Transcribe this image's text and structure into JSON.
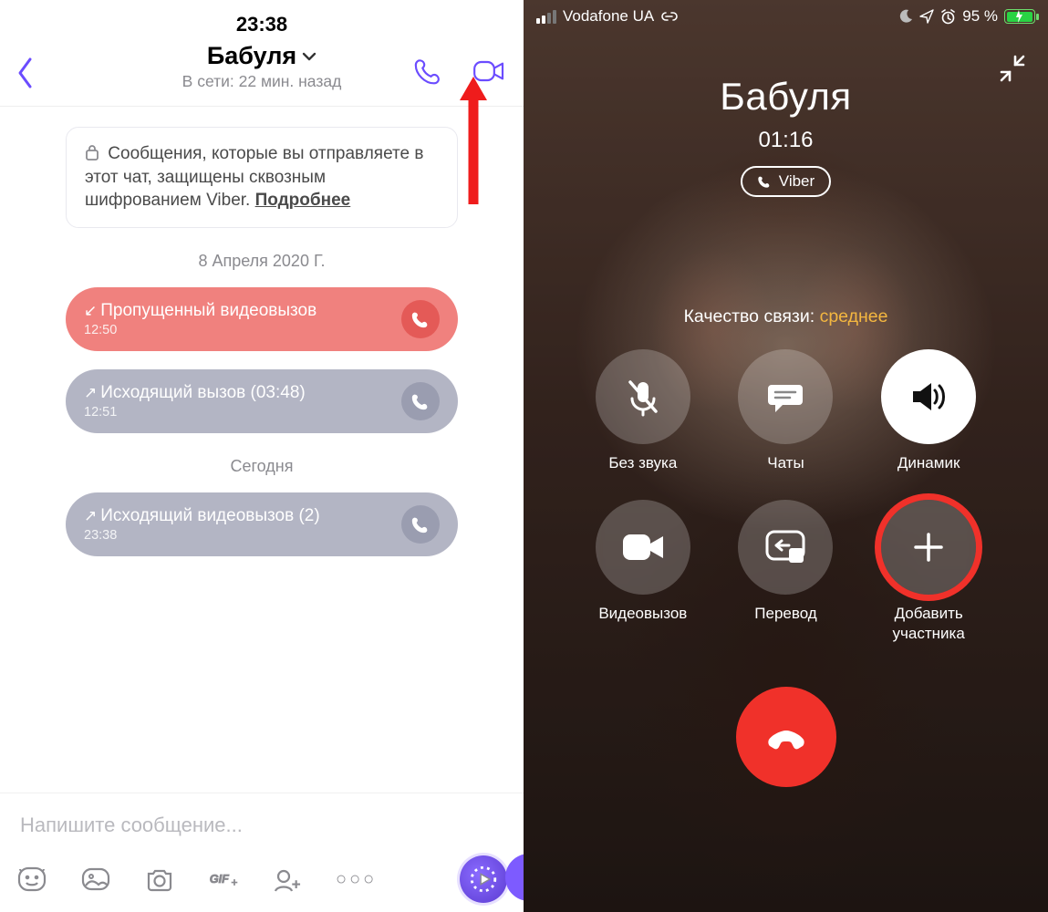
{
  "chat": {
    "clock": "23:38",
    "contact_name": "Бабуля",
    "status_line": "В сети: 22 мин. назад",
    "encryption_notice": "Сообщения, которые вы отправляете в этот чат, защищены сквозным шифрованием Viber.",
    "encryption_link": "Подробнее",
    "date_separator_1": "8 Апреля 2020 Г.",
    "date_separator_2": "Сегодня",
    "messages": [
      {
        "arrow": "↙",
        "text": "Пропущенный видеовызов",
        "time": "12:50"
      },
      {
        "arrow": "↗",
        "text": "Исходящий вызов (03:48)",
        "time": "12:51"
      },
      {
        "arrow": "↗",
        "text": "Исходящий видеовызов (2)",
        "time": "23:38"
      }
    ],
    "composer_placeholder": "Напишите сообщение..."
  },
  "call": {
    "carrier": "Vodafone UA",
    "battery_pct": "95 %",
    "contact_name": "Бабуля",
    "duration": "01:16",
    "app_pill": "Viber",
    "quality_label": "Качество связи: ",
    "quality_value": "среднее",
    "buttons": {
      "mute": "Без звука",
      "chats": "Чаты",
      "speaker": "Динамик",
      "video": "Видеовызов",
      "transfer": "Перевод",
      "add": "Добавить участника"
    }
  }
}
